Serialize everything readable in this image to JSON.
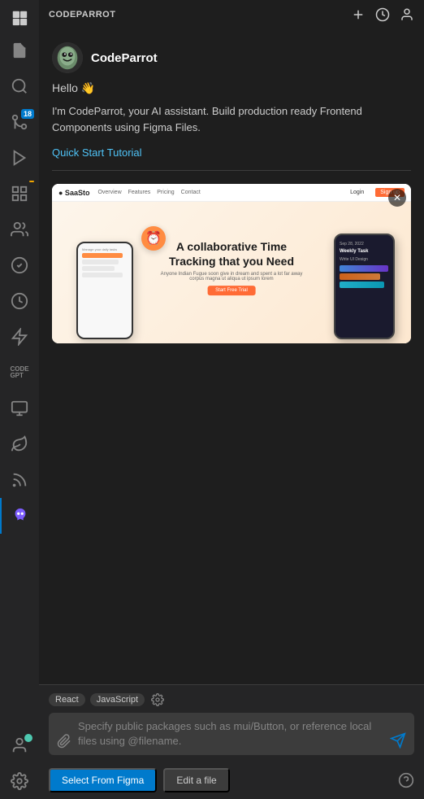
{
  "app": {
    "title": "CODEPARROT"
  },
  "header": {
    "title": "CODEPARROT",
    "actions": {
      "add": "+",
      "history": "history",
      "profile": "profile"
    }
  },
  "bot": {
    "name": "CodeParrot",
    "greeting": "Hello 👋",
    "description": "I'm CodeParrot, your AI assistant. Build production ready Frontend Components using Figma Files.",
    "quick_start": "Quick Start Tutorial"
  },
  "preview": {
    "close_label": "✕",
    "headline_line1": "A collaborative  Time",
    "headline_line2": "Tracking that you Need",
    "subtext": "Anyone Indian Fugue soon give in dream and spent a lot far away corpus magna ut aliqua ul ipsum lorem",
    "cta": "Start Free Trial",
    "weekly_task": "Weekly Task",
    "date": "Sep 28, 2022"
  },
  "input": {
    "tags": [
      "React",
      "JavaScript"
    ],
    "placeholder": "Specify public packages such as mui/Button, or reference local files using @filename."
  },
  "bottom_bar": {
    "figma_btn": "Select From Figma",
    "edit_btn": "Edit a file"
  },
  "sidebar": {
    "icons": [
      {
        "name": "copy-icon",
        "active": false
      },
      {
        "name": "search-icon",
        "active": false
      },
      {
        "name": "branch-icon",
        "active": false,
        "badge": "18"
      },
      {
        "name": "run-icon",
        "active": false
      },
      {
        "name": "layers-icon",
        "active": false,
        "badge_warning": true
      },
      {
        "name": "extensions-icon",
        "active": false
      },
      {
        "name": "people-icon",
        "active": false
      },
      {
        "name": "check-icon",
        "active": false
      },
      {
        "name": "timer-icon",
        "active": false
      },
      {
        "name": "bolt-icon",
        "active": false
      },
      {
        "name": "codegpt-icon",
        "active": false
      },
      {
        "name": "screen-icon",
        "active": false
      },
      {
        "name": "leaf-icon",
        "active": false
      },
      {
        "name": "rss-icon",
        "active": false
      },
      {
        "name": "bird-icon",
        "active": true
      }
    ],
    "bottom": [
      {
        "name": "user-icon"
      },
      {
        "name": "settings-icon"
      }
    ]
  }
}
